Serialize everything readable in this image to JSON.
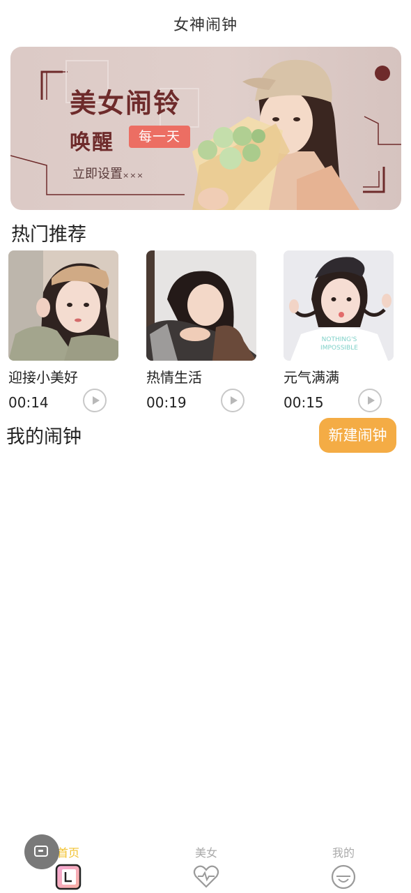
{
  "header": {
    "title": "女神闹钟"
  },
  "banner": {
    "headline": "美女闹铃",
    "sub": "唤醒",
    "tag": "每一天",
    "cta": "立即设置",
    "cta_suffix": "×××"
  },
  "hot": {
    "title": "热门推荐",
    "items": [
      {
        "name": "迎接小美好",
        "duration": "00:14",
        "shirt_text": ""
      },
      {
        "name": "热情生活",
        "duration": "00:19",
        "shirt_text": ""
      },
      {
        "name": "元气满满",
        "duration": "00:15",
        "shirt_text_1": "NOTHING'S",
        "shirt_text_2": "IMPOSSIBLE"
      }
    ]
  },
  "my_alarm": {
    "title": "我的闹钟",
    "new_button": "新建闹钟"
  },
  "nav": {
    "tabs": [
      {
        "label": "首页",
        "icon": "home-icon",
        "active": true
      },
      {
        "label": "美女",
        "icon": "heart-pulse-icon",
        "active": false
      },
      {
        "label": "我的",
        "icon": "smile-face-icon",
        "active": false
      }
    ]
  },
  "colors": {
    "accent_orange": "#f4ac45",
    "active_tab": "#f2c230",
    "banner_tag": "#ec6e63",
    "banner_text": "#6e2b2b"
  }
}
